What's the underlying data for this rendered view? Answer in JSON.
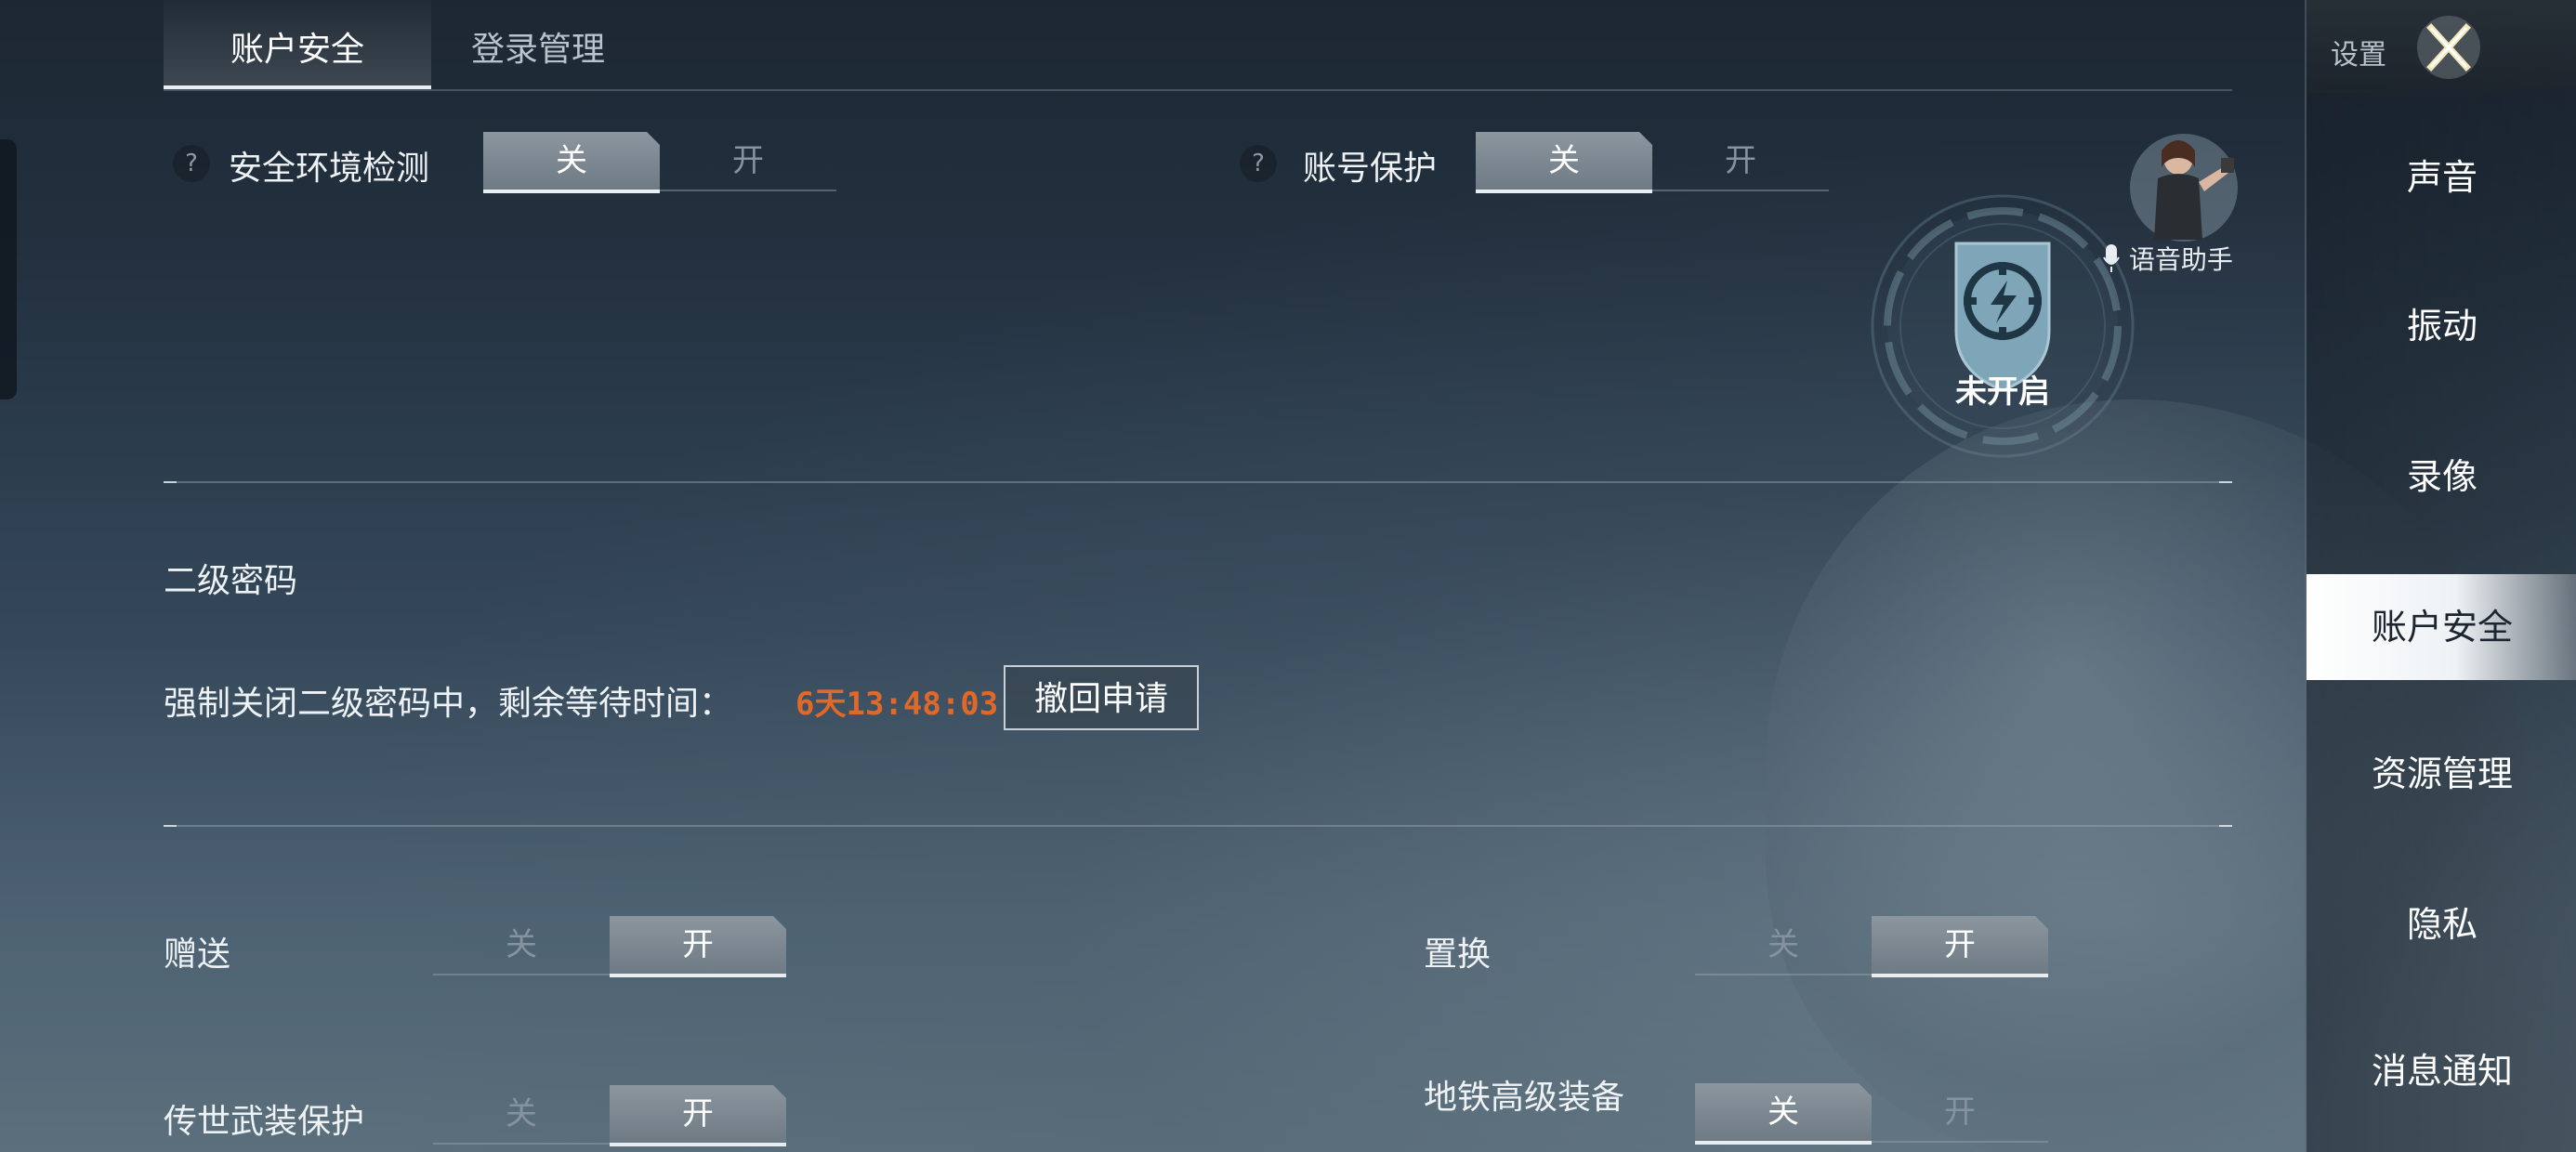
{
  "tabs": [
    {
      "label": "账户安全",
      "active": true
    },
    {
      "label": "登录管理",
      "active": false
    }
  ],
  "security_check": {
    "help": "?",
    "label": "安全环境检测",
    "off": "关",
    "on": "开",
    "value": "off"
  },
  "account_protect": {
    "help": "?",
    "label": "账号保护",
    "off": "关",
    "on": "开",
    "value": "off"
  },
  "shield_status": "未开启",
  "voice_assistant": {
    "label": "语音助手",
    "icon": "microphone-icon"
  },
  "secondary_password": {
    "title": "二级密码",
    "status_text": "强制关闭二级密码中，剩余等待时间：",
    "countdown": "6天13:48:03",
    "revoke_button": "撤回申请"
  },
  "gift": {
    "label": "赠送",
    "off": "关",
    "on": "开",
    "value": "on"
  },
  "exchange": {
    "label": "置换",
    "off": "关",
    "on": "开",
    "value": "on"
  },
  "legendary_weapon": {
    "label": "传世武装保护",
    "off": "关",
    "on": "开",
    "value": "on"
  },
  "metro_gear": {
    "label": "地铁高级装备",
    "off": "关",
    "on": "开",
    "value": "off"
  },
  "sidebar": {
    "title": "设置",
    "close_icon": "close-icon",
    "items": [
      {
        "label": "声音"
      },
      {
        "label": "振动"
      },
      {
        "label": "录像"
      },
      {
        "label": "账户安全",
        "active": true
      },
      {
        "label": "资源管理"
      },
      {
        "label": "隐私"
      },
      {
        "label": "消息通知"
      }
    ]
  },
  "colors": {
    "accent_orange": "#e0692a",
    "toggle_on": "#7a858f",
    "shield": "#7fa6b8"
  }
}
